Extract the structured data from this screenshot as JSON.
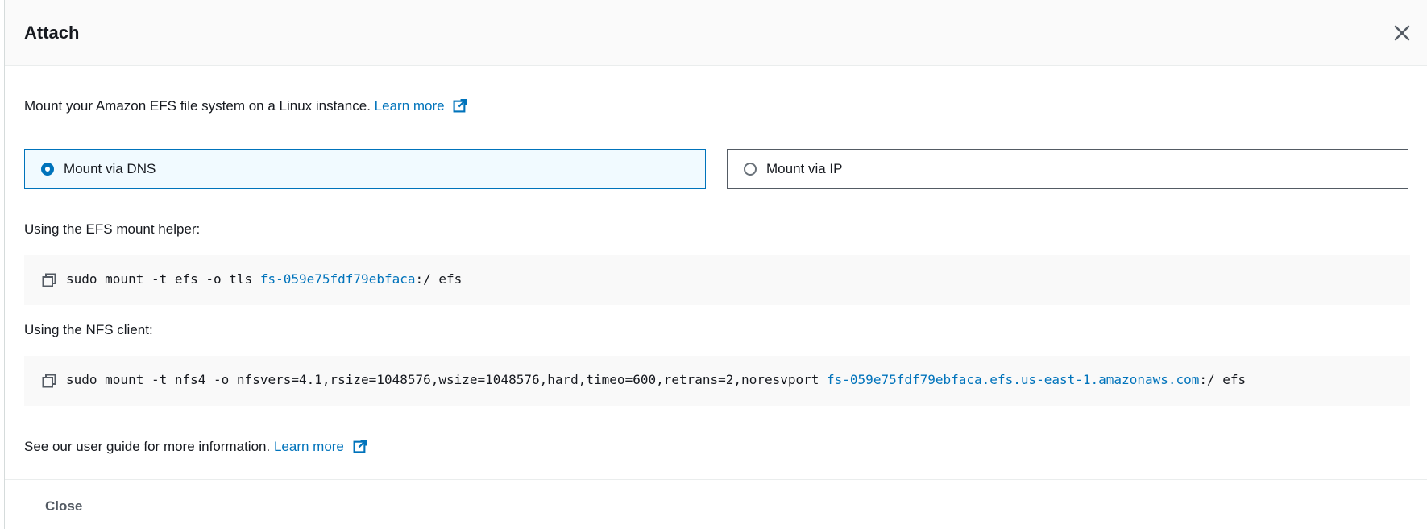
{
  "modal": {
    "title": "Attach",
    "close_icon": "close-icon"
  },
  "intro": {
    "text": "Mount your Amazon EFS file system on a Linux instance.",
    "link_label": "Learn more",
    "link_icon": "external-link-icon"
  },
  "mount_options": [
    {
      "label": "Mount via DNS",
      "selected": true
    },
    {
      "label": "Mount via IP",
      "selected": false
    }
  ],
  "efs_helper": {
    "label": "Using the EFS mount helper:",
    "command_prefix": "sudo mount -t efs -o tls ",
    "command_link": "fs-059e75fdf79ebfaca",
    "command_suffix": ":/ efs",
    "copy_icon": "copy-icon"
  },
  "nfs_client": {
    "label": "Using the NFS client:",
    "command_prefix": "sudo mount -t nfs4 -o nfsvers=4.1,rsize=1048576,wsize=1048576,hard,timeo=600,retrans=2,noresvport ",
    "command_link": "fs-059e75fdf79ebfaca.efs.us-east-1.amazonaws.com",
    "command_suffix": ":/ efs",
    "copy_icon": "copy-icon"
  },
  "footer": {
    "info_text": "See our user guide for more information.",
    "link_label": "Learn more",
    "close_label": "Close"
  },
  "colors": {
    "accent": "#0073bb",
    "text": "#16191f",
    "code_bg": "#f9f9f9"
  }
}
